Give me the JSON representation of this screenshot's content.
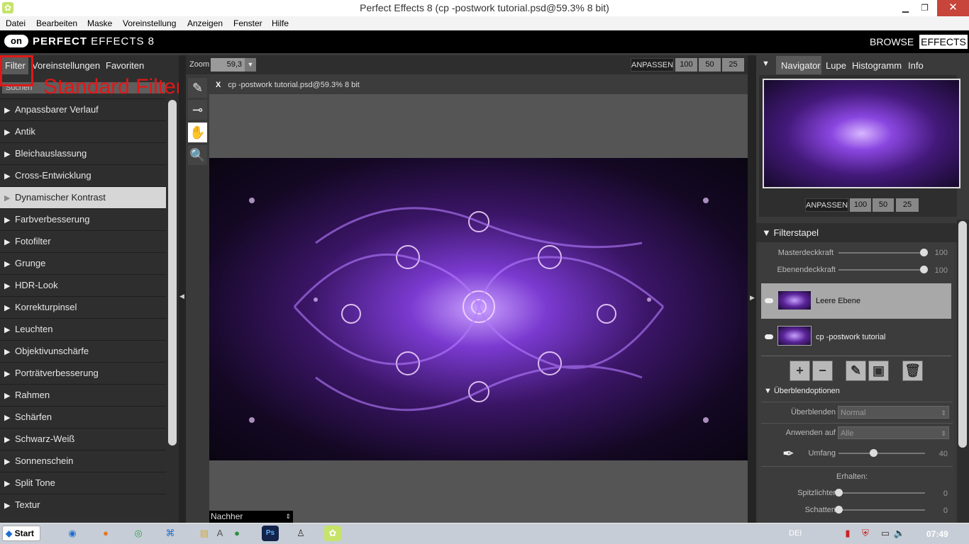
{
  "window": {
    "title": "Perfect Effects 8 (cp -postwork tutorial.psd@59.3% 8 bit)",
    "minimize": "▁",
    "maximize": "❐",
    "close": "✕"
  },
  "menu": [
    "Datei",
    "Bearbeiten",
    "Maske",
    "Voreinstellung",
    "Anzeigen",
    "Fenster",
    "Hilfe"
  ],
  "brand": {
    "logo": "on",
    "name_bold": "PERFECT",
    "name_rest": " EFFECTS 8",
    "browse": "BROWSE",
    "effects": "EFFECTS"
  },
  "left_tabs": [
    "Filter",
    "Voreinstellungen",
    "Favoriten"
  ],
  "search_placeholder": "Suchen",
  "annotation": "Standard Filter",
  "filters": [
    "Anpassbarer Verlauf",
    "Antik",
    "Bleichauslassung",
    "Cross-Entwicklung",
    "Dynamischer Kontrast",
    "Farbverbesserung",
    "Fotofilter",
    "Grunge",
    "HDR-Look",
    "Korrekturpinsel",
    "Leuchten",
    "Objektivunschärfe",
    "Porträtverbesserung",
    "Rahmen",
    "Schärfen",
    "Schwarz-Weiß",
    "Sonnenschein",
    "Split Tone",
    "Textur"
  ],
  "selected_filter": "Dynamischer Kontrast",
  "toolbar": {
    "zoom_label": "Zoom",
    "zoom_value": "59,3",
    "fit": "ANPASSEN",
    "z100": "100",
    "z50": "50",
    "z25": "25"
  },
  "doc_tab": {
    "close": "X",
    "name": "cp -postwork tutorial.psd@59.3% 8 bit"
  },
  "view_select": "Nachher",
  "right_tabs": [
    "Navigator",
    "Lupe",
    "Histogramm",
    "Info"
  ],
  "nav_zoom": {
    "fit": "ANPASSEN",
    "z100": "100",
    "z50": "50",
    "z25": "25"
  },
  "filterstack": {
    "title": "Filterstapel",
    "master_label": "Masterdeckkraft",
    "master_value": "100",
    "layer_label": "Ebenendeckkraft",
    "layer_value": "100",
    "layers": [
      "Leere Ebene",
      "cp -postwork tutorial"
    ],
    "blend_title": "Überblendoptionen",
    "blend_label": "Überblenden",
    "blend_value": "Normal",
    "apply_label": "Anwenden auf",
    "apply_value": "Alle",
    "amount_label": "Umfang",
    "amount_value": "40",
    "preserve_label": "Erhalten:",
    "highlights_label": "Spitzlichter",
    "highlights_value": "0",
    "shadows_label": "Schatten",
    "shadows_value": "0"
  },
  "slider_levels": {
    "master": 1.0,
    "layer": 1.0,
    "amount": 0.4,
    "highlights": 0.0,
    "shadows": 0.0
  },
  "taskbar": {
    "start": "Start",
    "clock": "07:49",
    "tray_text": "DEI"
  }
}
